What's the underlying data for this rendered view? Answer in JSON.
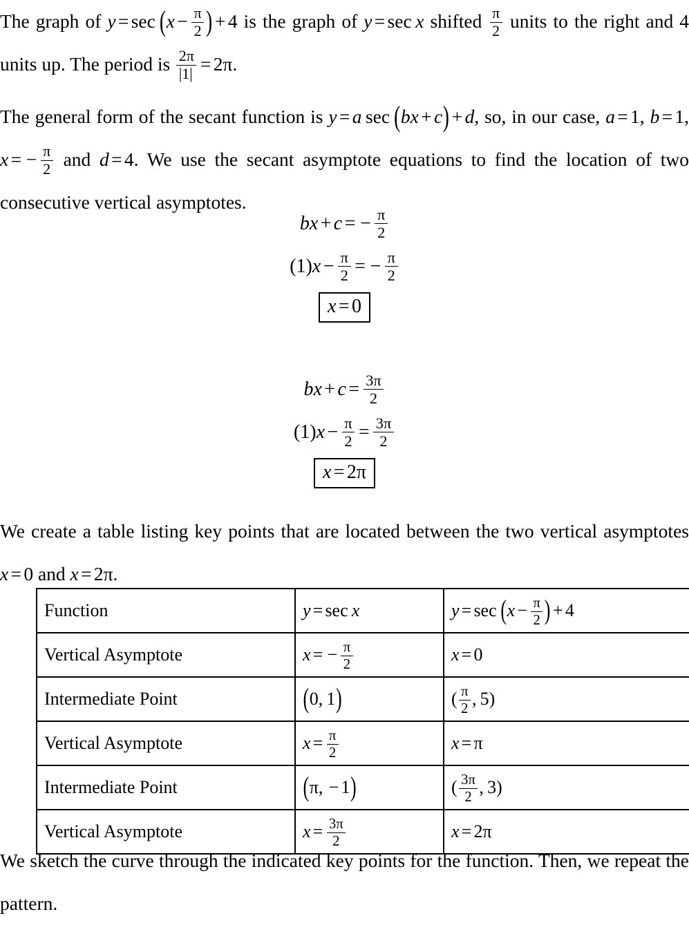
{
  "document": {
    "type": "math-worked-solution",
    "topic": "Graphing y = sec(x - pi/2) + 4",
    "text_color": "#000000",
    "background_color": "#ffffff"
  },
  "paragraph1": {
    "id": "intro-paragraph",
    "plain_text": "The graph of y = sec (x - π/2) + 4 is the graph of y = sec x shifted π/2 units to the right and 4 units up. The period is 2π/|1| = 2π.",
    "segments": {
      "s1": "The graph of",
      "eq1": "y = sec (x − π/2) + 4",
      "s2": "is the graph of",
      "eq2": "y = sec x",
      "s3": "shifted",
      "eq3": "π/2",
      "s4": "units to the right and 4 units up. The period is",
      "eq4": "2π/|1| = 2π."
    }
  },
  "paragraph2": {
    "id": "general-form-paragraph",
    "plain_text": "The general form of the secant function is y = a sec (bx + c) + d, so, in our case, a = 1, b = 1, x = -π/2 and d = 4. We use the secant asymptote equations to find the location of two consecutive vertical asymptotes.",
    "segments": {
      "s1": "The general form of the secant function is",
      "eq1": "y = a sec (bx + c) + d,",
      "s2": "so, in our case,",
      "eq2": "a = 1,",
      "eq3": "b = 1,",
      "eq4": "x = −π/2",
      "s3": "and",
      "eq5": "d = 4.",
      "s4": "We use the secant asymptote equations to find the location of two consecutive vertical asymptotes."
    }
  },
  "equation_block_1": {
    "id": "first-asymptote-derivation",
    "line1": "bx + c = −π/2",
    "line2": "(1)x − π/2 = −π/2",
    "result": "x = 0",
    "result_boxed": true,
    "parts": {
      "b": "b",
      "x": "x",
      "plus": "+",
      "c": "c",
      "equals": "=",
      "minus": "−",
      "pi": "π",
      "two": "2",
      "one_paren": "(1)",
      "zero": "0"
    }
  },
  "equation_block_2": {
    "id": "second-asymptote-derivation",
    "line1": "bx + c = 3π/2",
    "line2": "(1)x − π/2 = 3π/2",
    "result": "x = 2π",
    "result_boxed": true,
    "parts": {
      "three_pi": "3π",
      "two": "2",
      "two_pi": "2π"
    }
  },
  "paragraph3": {
    "id": "table-intro-paragraph",
    "plain_text": "We create a table listing key points that are located between the two vertical asymptotes x = 0 and x = 2π.",
    "segments": {
      "s1": "We create a table listing key points that are located between the two vertical asymptotes",
      "eq1": "x = 0",
      "s2": "and",
      "eq2": "x = 2π."
    }
  },
  "key_points_table": {
    "id": "key-points-table",
    "border_color": "#000000",
    "columns": [
      "Function",
      "y = sec x",
      "y = sec (x − π/2) + 4"
    ],
    "rows": [
      {
        "label": "Function",
        "base": "y = sec x",
        "transformed": "y = sec (x − π/2) + 4",
        "is_header": true
      },
      {
        "label": "Vertical Asymptote",
        "base": "x = −π/2",
        "transformed": "x = 0"
      },
      {
        "label": "Intermediate Point",
        "base": "(0, 1)",
        "transformed": "(π/2, 5)"
      },
      {
        "label": "Vertical Asymptote",
        "base": "x = π/2",
        "transformed": "x = π"
      },
      {
        "label": "Intermediate Point",
        "base": "(π, −1)",
        "transformed": "(3π/2, 3)"
      },
      {
        "label": "Vertical Asymptote",
        "base": "x = 3π/2",
        "transformed": "x = 2π"
      }
    ],
    "row_labels": {
      "r0": "Function",
      "r1": "Vertical Asymptote",
      "r2": "Intermediate Point",
      "r3": "Vertical Asymptote",
      "r4": "Intermediate Point",
      "r5": "Vertical Asymptote"
    }
  },
  "paragraph4": {
    "id": "closing-paragraph",
    "plain_text": "We sketch the curve through the indicated key points for the function. Then, we repeat the pattern.",
    "segments": {
      "s1": "We sketch the curve through the indicated key points for the function.",
      "s2": "Then,",
      "s3": "we repeat the pattern."
    }
  },
  "symbols": {
    "pi": "π",
    "minus": "−",
    "equals": "=",
    "plus": "+",
    "sec": "sec",
    "comma": ",",
    "lparen": "(",
    "rparen": ")",
    "abs": "|"
  }
}
